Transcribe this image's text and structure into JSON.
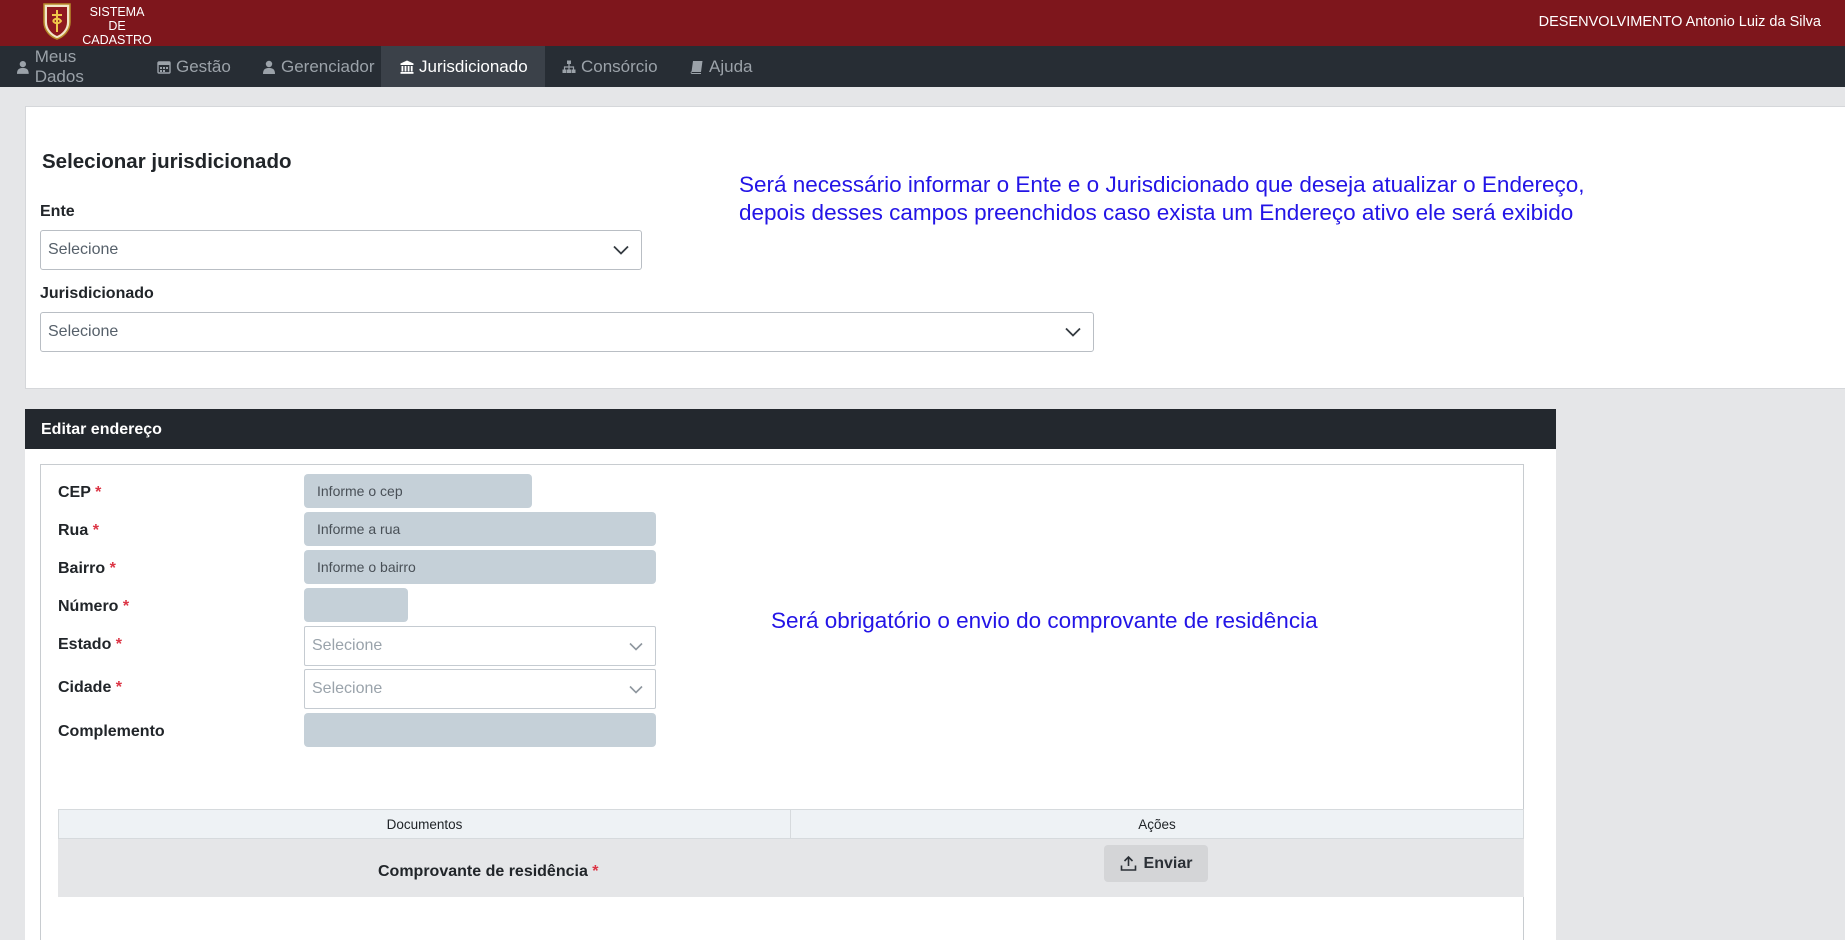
{
  "header": {
    "brand_line1": "SISTEMA DE",
    "brand_line2": "CADASTRO",
    "user_text": "DESENVOLVIMENTO Antonio Luiz da Silva",
    "bg_color": "#7e161c"
  },
  "nav": {
    "items": [
      {
        "label": "Meus Dados",
        "icon": "user-icon"
      },
      {
        "label": "Gestão",
        "icon": "calendar-icon"
      },
      {
        "label": "Gerenciador",
        "icon": "user-icon"
      },
      {
        "label": "Jurisdicionado",
        "icon": "institution-icon",
        "active": true
      },
      {
        "label": "Consórcio",
        "icon": "sitemap-icon"
      },
      {
        "label": "Ajuda",
        "icon": "book-icon"
      }
    ]
  },
  "select_section": {
    "title": "Selecionar jurisdicionado",
    "ente_label": "Ente",
    "ente_value": "Selecione",
    "jurisdicionado_label": "Jurisdicionado",
    "jurisdicionado_value": "Selecione",
    "note_line1": "Será necessário informar o Ente e o Jurisdicionado que deseja atualizar o Endereço,",
    "note_line2": "depois desses campos preenchidos caso exista um Endereço ativo ele será exibido"
  },
  "address": {
    "header": "Editar endereço",
    "fields": {
      "cep": {
        "label": "CEP",
        "placeholder": "Informe o cep"
      },
      "rua": {
        "label": "Rua",
        "placeholder": "Informe a rua"
      },
      "bairro": {
        "label": "Bairro",
        "placeholder": "Informe o bairro"
      },
      "numero": {
        "label": "Número",
        "placeholder": ""
      },
      "estado": {
        "label": "Estado",
        "value": "Selecione"
      },
      "cidade": {
        "label": "Cidade",
        "value": "Selecione"
      },
      "complemento": {
        "label": "Complemento",
        "placeholder": ""
      }
    },
    "required_mark": "*",
    "note": "Será obrigatório o envio do comprovante de residência"
  },
  "documents": {
    "columns": [
      "Documentos",
      "Ações"
    ],
    "rows": [
      {
        "document": "Comprovante de residência",
        "action": "Enviar"
      }
    ]
  }
}
